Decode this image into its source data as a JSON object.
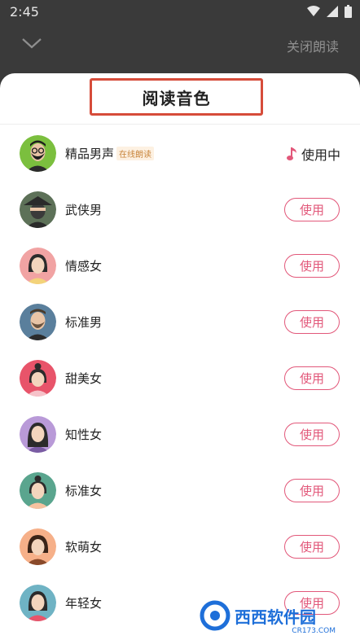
{
  "status": {
    "time": "2:45"
  },
  "topbar": {
    "close_label": "关闭朗读"
  },
  "sheet": {
    "title": "阅读音色"
  },
  "voices": [
    {
      "name": "精品男声",
      "tag": "在线朗读",
      "state": "使用中",
      "avatar": "man-glasses-beard"
    },
    {
      "name": "武侠男",
      "action": "使用",
      "avatar": "masked-swordsman"
    },
    {
      "name": "情感女",
      "action": "使用",
      "avatar": "woman-short-hair"
    },
    {
      "name": "标准男",
      "action": "使用",
      "avatar": "man-beard"
    },
    {
      "name": "甜美女",
      "action": "使用",
      "avatar": "girl-buns"
    },
    {
      "name": "知性女",
      "action": "使用",
      "avatar": "woman-long-hair"
    },
    {
      "name": "标准女",
      "action": "使用",
      "avatar": "woman-bun"
    },
    {
      "name": "软萌女",
      "action": "使用",
      "avatar": "girl-bob"
    },
    {
      "name": "年轻女",
      "action": "使用",
      "avatar": "young-woman"
    }
  ],
  "watermark": {
    "brand": "西西软件园",
    "site": "CR173.COM"
  },
  "colors": {
    "accent": "#e2587a",
    "highlight_box": "#d64c3a"
  }
}
